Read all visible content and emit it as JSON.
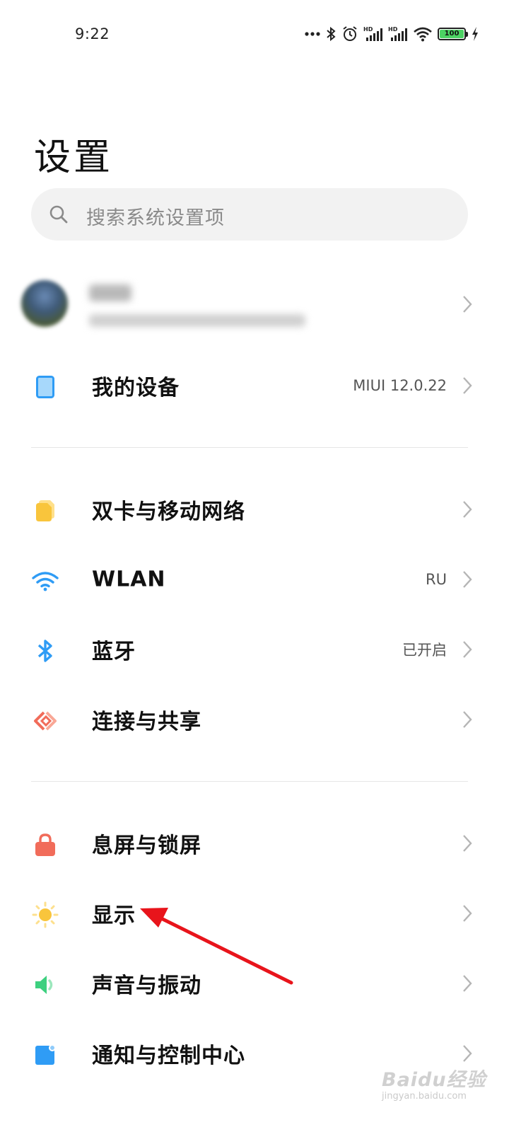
{
  "status_bar": {
    "time": "9:22",
    "battery": "100",
    "icons": [
      "more-dots-icon",
      "bluetooth-icon",
      "alarm-icon",
      "hd-signal-icon",
      "hd-signal-icon",
      "wifi-icon",
      "battery-icon",
      "charging-icon"
    ]
  },
  "title": "设置",
  "search": {
    "placeholder": "搜索系统设置项"
  },
  "my_device": {
    "label": "我的设备",
    "value": "MIUI 12.0.22",
    "icon": "tablet-icon"
  },
  "network_section": [
    {
      "label": "双卡与移动网络",
      "value": "",
      "icon": "sim-card-icon"
    },
    {
      "label": "WLAN",
      "value": "RU",
      "icon": "wifi-icon"
    },
    {
      "label": "蓝牙",
      "value": "已开启",
      "icon": "bluetooth-icon"
    },
    {
      "label": "连接与共享",
      "value": "",
      "icon": "share-connection-icon"
    }
  ],
  "system_section": [
    {
      "label": "息屏与锁屏",
      "value": "",
      "icon": "lock-icon"
    },
    {
      "label": "显示",
      "value": "",
      "icon": "brightness-icon"
    },
    {
      "label": "声音与振动",
      "value": "",
      "icon": "speaker-icon"
    },
    {
      "label": "通知与控制中心",
      "value": "",
      "icon": "notification-icon"
    }
  ],
  "colors": {
    "accent_blue": "#2f9cf5",
    "sim_yellow": "#f9c53c",
    "lock_red": "#f16c5a",
    "sun_yellow": "#f9c53c",
    "sound_green": "#3dd07f",
    "arrow_red": "#e8141b"
  },
  "watermark": {
    "text": "Baidu经验",
    "sub": "jingyan.baidu.com"
  }
}
